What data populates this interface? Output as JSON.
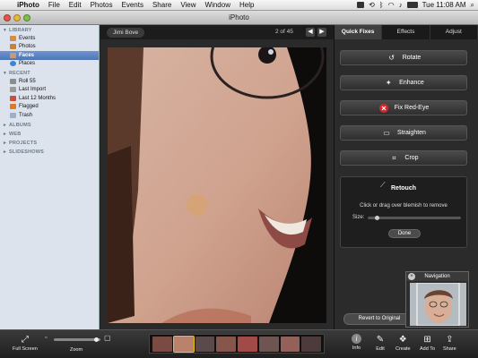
{
  "menubar": {
    "app_name": "iPhoto",
    "items": [
      "File",
      "Edit",
      "Photos",
      "Events",
      "Share",
      "View",
      "Window",
      "Help"
    ],
    "clock": "Tue 11:08 AM"
  },
  "window": {
    "title": "iPhoto"
  },
  "sidebar": {
    "library_header": "LIBRARY",
    "library_items": [
      "Events",
      "Photos",
      "Faces",
      "Places"
    ],
    "recent_header": "RECENT",
    "recent_items": [
      "Roll 55",
      "Last Import",
      "Last 12 Months",
      "Flagged",
      "Trash"
    ],
    "albums_header": "ALBUMS",
    "web_header": "WEB",
    "projects_header": "PROJECTS",
    "slideshows_header": "SLIDESHOWS"
  },
  "viewer": {
    "event_label": "Jimi Bove",
    "counter": "2 of 45",
    "prev_arrow": "◀",
    "next_arrow": "▶"
  },
  "edit_panel": {
    "tabs": [
      "Quick Fixes",
      "Effects",
      "Adjust"
    ],
    "buttons": [
      "Rotate",
      "Enhance",
      "Fix Red-Eye",
      "Straighten",
      "Crop"
    ],
    "retouch": {
      "title": "Retouch",
      "help": "Click or drag over blemish to remove",
      "size_label": "Size:",
      "size_value": 0.08,
      "done_label": "Done"
    },
    "revert_label": "Revert to Original"
  },
  "navigation": {
    "title": "Navigation",
    "close": "×"
  },
  "toolbar": {
    "full_screen": "Full Screen",
    "zoom": "Zoom",
    "zoom_value": 0.95,
    "info": "Info",
    "edit": "Edit",
    "create": "Create",
    "add_to": "Add To",
    "share": "Share"
  },
  "colors": {
    "selection_blue": "#4d76b7",
    "redeye_red": "#d7262b",
    "filmstrip_selected": "#f1c500"
  }
}
